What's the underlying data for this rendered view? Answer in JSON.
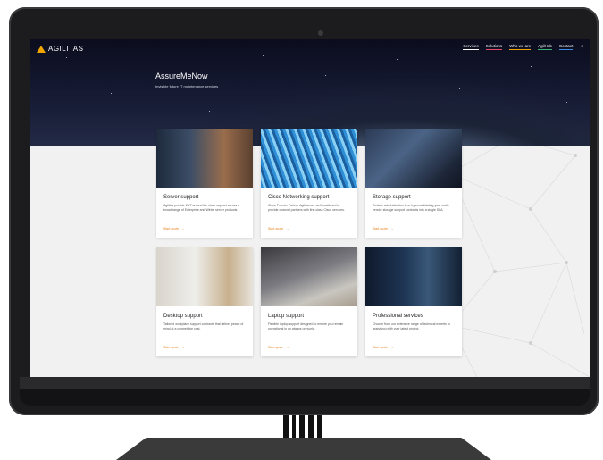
{
  "site": {
    "logo": "AGILITAS",
    "nav": [
      "Services",
      "Solutions",
      "Who we are",
      "AgilHub",
      "Contact"
    ],
    "nav_colors": [
      "#ffffff",
      "#e84a6b",
      "#f0a400",
      "#3bb27a",
      "#3a8be8"
    ],
    "account_icon": "user-icon"
  },
  "hero": {
    "title": "AssureMeNow",
    "subtitle": "Invisible future IT maintenance services"
  },
  "cards": [
    {
      "title": "Server support",
      "desc": "Agilitas provide 24/7 around the clock support across a broad range of Enterprise and Wintel server products.",
      "link": "Start quote"
    },
    {
      "title": "Cisco Networking support",
      "desc": "Cisco Premier Partner Agilitas are well positioned to provide channel partners with first-class Cisco services.",
      "link": "Start quote"
    },
    {
      "title": "Storage support",
      "desc": "Reduce administration time by consolidating your multi-vendor storage support contracts into a single SLA.",
      "link": "Start quote"
    },
    {
      "title": "Desktop support",
      "desc": "Tailored workplace support contracts that deliver peace of mind at a competitive cost.",
      "link": "Start quote"
    },
    {
      "title": "Laptop support",
      "desc": "Flexible laptop support designed to ensure you remain operational in an always on world.",
      "link": "Start quote"
    },
    {
      "title": "Professional services",
      "desc": "Choose from our extensive range of technical experts to assist you with your latest project.",
      "link": "Start quote"
    }
  ],
  "accent": "#e8801c"
}
